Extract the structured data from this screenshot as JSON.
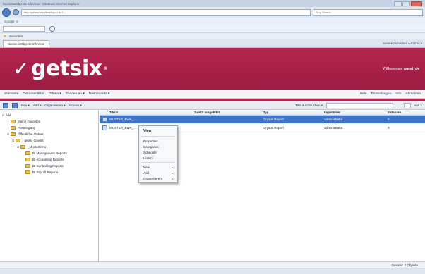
{
  "browser": {
    "window_title": "BusinessObjects InfoView - Windows Internet Explorer",
    "address": "http://getsix/InfoView/logon.do?...",
    "search_placeholder": "Bing Search",
    "menu": "Google  G-",
    "links_label": "Favoriten",
    "tab_label": "BusinessObjects InfoView",
    "tab_tools": "Seite ▾  Sicherheit ▾  Extras ▾"
  },
  "banner": {
    "logo_text": "getsix",
    "logo_reg": "®",
    "welcome_label": "Willkommen:",
    "welcome_user": "guest_de"
  },
  "bonav": {
    "items": [
      "Startseite",
      "Dokumentliste",
      "Öffnen ▾",
      "Senden an ▾",
      "Dashboards ▾"
    ],
    "right": [
      "Hilfe",
      "Einstellungen",
      "Info",
      "Abmelden"
    ]
  },
  "toolbar": {
    "items": [
      "Neu ▾",
      "Add ▾",
      "Organisieren ▾",
      "Actions ▾"
    ],
    "search_label": "Titel durchsuchen ▾",
    "pager": "von 1"
  },
  "tree": [
    {
      "label": "Alle",
      "indent": 0,
      "icon": false
    },
    {
      "label": "Meine Favoriten",
      "indent": 1,
      "icon": true
    },
    {
      "label": "Posteingang",
      "indent": 1,
      "icon": true
    },
    {
      "label": "Öffentliche Ordner",
      "indent": 1,
      "icon": true
    },
    {
      "label": "_getsix Guests",
      "indent": 2,
      "icon": true
    },
    {
      "label": "_Musterfirma",
      "indent": 3,
      "icon": true
    },
    {
      "label": "BI Management Reports",
      "indent": 4,
      "icon": true
    },
    {
      "label": "BI Accounting Reports",
      "indent": 4,
      "icon": true
    },
    {
      "label": "BI Controlling Reports",
      "indent": 4,
      "icon": true
    },
    {
      "label": "BI Payroll Reports",
      "indent": 4,
      "icon": true
    }
  ],
  "table": {
    "headers": [
      "",
      "Titel ^",
      "Zuletzt ausgeführt",
      "Typ",
      "Eigentümer",
      "Instanzen"
    ],
    "rows": [
      {
        "title": "MUSTER_BWA_...",
        "last_run": "",
        "type": "Crystal Report",
        "owner": "Administrator",
        "instances": "0",
        "selected": true
      },
      {
        "title": "MUSTER_BWA_...",
        "last_run": "",
        "type": "Crystal Report",
        "owner": "Administrator",
        "instances": "0",
        "selected": false
      }
    ]
  },
  "context_menu": {
    "items": [
      {
        "label": "View",
        "bold": true,
        "arrow": false
      },
      {
        "label": "Properties",
        "bold": false,
        "arrow": false
      },
      {
        "label": "Categories",
        "bold": false,
        "arrow": false
      },
      {
        "label": "Schedule",
        "bold": false,
        "arrow": false
      },
      {
        "label": "History",
        "bold": false,
        "arrow": false
      },
      {
        "label": "New",
        "bold": false,
        "arrow": true
      },
      {
        "label": "Add",
        "bold": false,
        "arrow": true
      },
      {
        "label": "Organisieren",
        "bold": false,
        "arrow": true
      }
    ]
  },
  "status": {
    "total": "Gesamt: 2 Objekte"
  },
  "colors": {
    "brand": "#b3244e",
    "selection": "#3d73c9"
  }
}
